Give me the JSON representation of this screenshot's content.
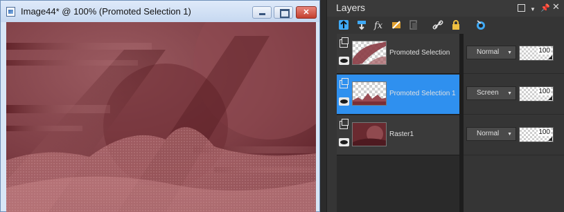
{
  "image_window": {
    "title": "Image44* @ 100% (Promoted Selection 1)",
    "minimize_icon": "minimize-icon",
    "maximize_icon": "maximize-icon",
    "close_label": "✕"
  },
  "layers_panel": {
    "title": "Layers",
    "header_icons": [
      "restore-icon",
      "dropdown-icon",
      "pin-icon",
      "close-icon"
    ],
    "toolbar_icons": [
      "new-raster-layer-icon",
      "new-vector-layer-icon",
      "new-mask-layer-icon",
      "new-adjustment-layer-icon",
      "duplicate-layer-icon",
      "link-icon",
      "lock-icon",
      "visibility-toggle-icon"
    ],
    "layers": [
      {
        "name": "Promoted Selection",
        "blend_mode": "Normal",
        "opacity": "100",
        "selected": false
      },
      {
        "name": "Promoted Selection 1",
        "blend_mode": "Screen",
        "opacity": "100",
        "selected": true
      },
      {
        "name": "Raster1",
        "blend_mode": "Normal",
        "opacity": "100",
        "selected": false
      }
    ]
  },
  "colors": {
    "selection_blue": "#2f90ef",
    "panel_bg": "#353535",
    "canvas_red": "#7a3a40"
  }
}
